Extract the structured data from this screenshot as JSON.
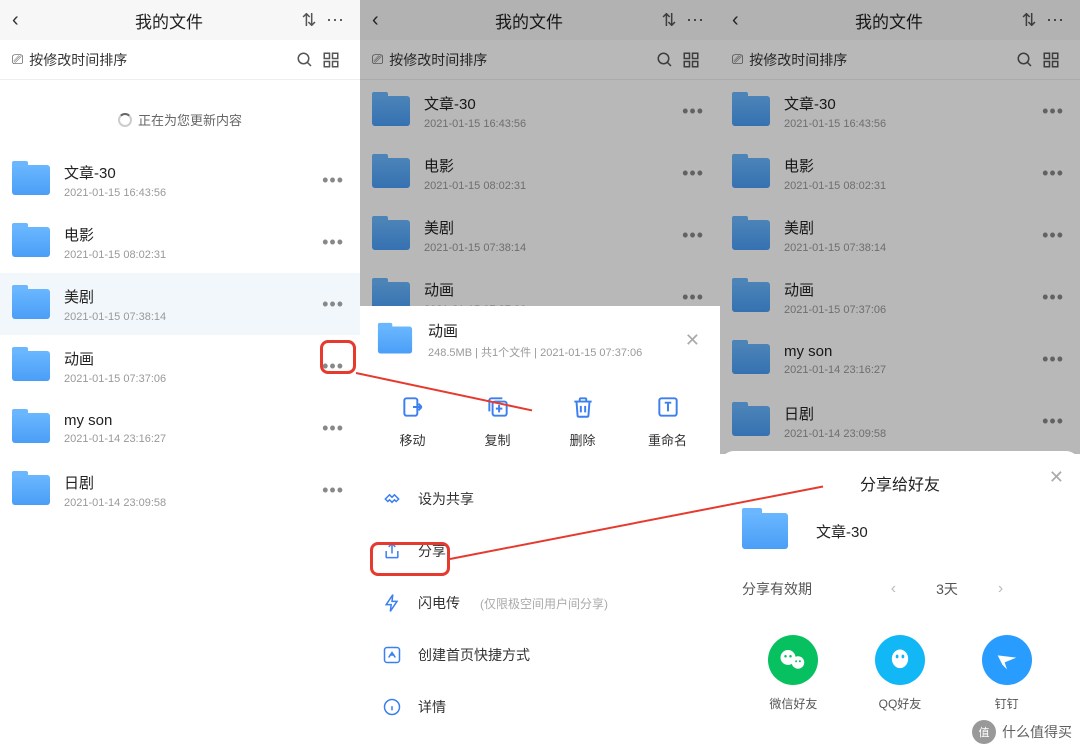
{
  "header": {
    "title": "我的文件",
    "sort_label": "按修改时间排序"
  },
  "loading_text": "正在为您更新内容",
  "files": [
    {
      "name": "文章-30",
      "date": "2021-01-15 16:43:56"
    },
    {
      "name": "电影",
      "date": "2021-01-15 08:02:31"
    },
    {
      "name": "美剧",
      "date": "2021-01-15 07:38:14"
    },
    {
      "name": "动画",
      "date": "2021-01-15 07:37:06"
    },
    {
      "name": "my son",
      "date": "2021-01-14 23:16:27"
    },
    {
      "name": "日剧",
      "date": "2021-01-14 23:09:58"
    }
  ],
  "sheet": {
    "title": "动画",
    "sub": "248.5MB | 共1个文件 | 2021-01-15 07:37:06",
    "actions": {
      "move": "移动",
      "copy": "复制",
      "delete": "删除",
      "rename": "重命名"
    },
    "menu": {
      "share_set": "设为共享",
      "share": "分享",
      "flash": "闪电传",
      "flash_hint": "(仅限极空间用户间分享)",
      "shortcut": "创建首页快捷方式",
      "details": "详情"
    }
  },
  "share": {
    "title": "分享给好友",
    "file_name": "文章-30",
    "expiry_label": "分享有效期",
    "expiry_value": "3天",
    "apps": {
      "wechat": "微信好友",
      "qq": "QQ好友",
      "ding": "钉钉"
    }
  },
  "watermark": {
    "badge": "值",
    "text": "什么值得买"
  }
}
